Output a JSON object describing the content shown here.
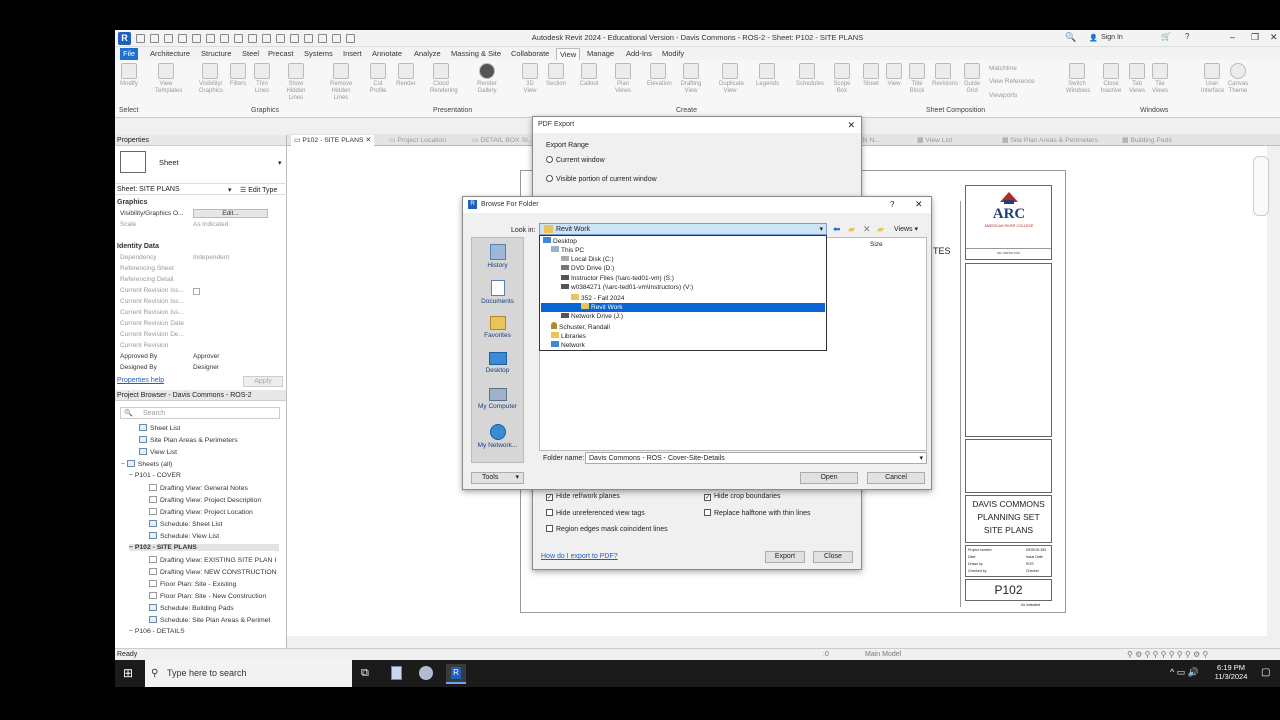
{
  "window": {
    "title": "Autodesk Revit 2024 - Educational Version - Davis Commons - ROS-2 - Sheet: P102 - SITE PLANS",
    "sign_in": "Sign In"
  },
  "ribbon_tabs": [
    "File",
    "Architecture",
    "Structure",
    "Steel",
    "Precast",
    "Systems",
    "Insert",
    "Annotate",
    "Analyze",
    "Massing & Site",
    "Collaborate",
    "View",
    "Manage",
    "Add-Ins",
    "Modify"
  ],
  "ribbon_tools": [
    "Modify",
    "View Templates",
    "Visibility/ Graphics",
    "Filters",
    "Thin Lines",
    "Show Hidden Lines",
    "Remove Hidden Lines",
    "Cut Profile",
    "Render",
    "Cloud Rendering",
    "Render Gallery",
    "3D View",
    "Section",
    "Callout",
    "Plan Views",
    "Elevation",
    "Drafting View",
    "Duplicate View",
    "Legends",
    "Schedules",
    "Scope Box",
    "Sheet",
    "View",
    "Title Block",
    "Revisions",
    "Guide Grid",
    "Matchline",
    "View Reference",
    "Viewports",
    "Switch Windows",
    "Close Inactive",
    "Tab Views",
    "Tile Views",
    "User Interface",
    "Canvas Theme"
  ],
  "ribbon_panels": [
    "Select",
    "Graphics",
    "Presentation",
    "Create",
    "Sheet Composition",
    "Windows"
  ],
  "properties": {
    "header": "Properties",
    "type": "Sheet",
    "selector": "Sheet: SITE PLANS",
    "edit_type": "Edit Type",
    "groups": {
      "graphics": "Graphics",
      "identity": "Identity Data"
    },
    "rows": [
      {
        "k": "Visibility/Graphics O...",
        "v": "Edit..."
      },
      {
        "k": "Scale",
        "v": "As indicated"
      },
      {
        "k": "Dependency",
        "v": "Independent"
      },
      {
        "k": "Referencing Sheet",
        "v": ""
      },
      {
        "k": "Referencing Detail",
        "v": ""
      },
      {
        "k": "Current Revision Iss...",
        "v": ""
      },
      {
        "k": "Current Revision Iss...",
        "v": ""
      },
      {
        "k": "Current Revision Iss...",
        "v": ""
      },
      {
        "k": "Current Revision Date",
        "v": ""
      },
      {
        "k": "Current Revision De...",
        "v": ""
      },
      {
        "k": "Current Revision",
        "v": ""
      },
      {
        "k": "Approved By",
        "v": "Approver"
      },
      {
        "k": "Designed By",
        "v": "Designer"
      }
    ],
    "help": "Properties help",
    "apply": "Apply"
  },
  "project_browser": {
    "header": "Project Browser - Davis Commons - ROS-2",
    "search_placeholder": "Search",
    "items": [
      "Sheet List",
      "Site Plan Areas & Perimeters",
      "View List",
      "Sheets (all)",
      "P101 - COVER",
      "Drafting View: General Notes",
      "Drafting View: Project Description",
      "Drafting View: Project Location",
      "Schedule: Sheet List",
      "Schedule: View List",
      "P102 - SITE PLANS",
      "Drafting View: EXISTING SITE PLAN I",
      "Drafting View: NEW CONSTRUCTION",
      "Floor Plan: Site - Existing",
      "Floor Plan: Site - New Construction",
      "Schedule: Building Pads",
      "Schedule: Site Plan Areas & Perimet",
      "P106 - DETAILS"
    ]
  },
  "view_tabs": [
    "P102 - SITE PLANS",
    "Project Location",
    "DETAIL BOX SI...",
    "... PLAN N...",
    "View List",
    "Site Plan Areas & Perimeters",
    "Building Pads"
  ],
  "sheet": {
    "school": "ARC",
    "school_sub": "AMERICAN RIVER COLLEGE",
    "school_url": "arc.losrios.edu",
    "project": [
      "DAVIS COMMONS",
      "PLANNING SET",
      "SITE PLANS"
    ],
    "number": "P102",
    "tbl_labels": [
      "Project number",
      "Date",
      "Drawn by",
      "Checked by"
    ],
    "tbl_values": [
      "DESIGN 352",
      "Issue Date",
      "ROS",
      "Checker"
    ],
    "scale": "As indicated",
    "note_tag": "TES"
  },
  "pdf_export": {
    "title": "PDF Export",
    "export_range": "Export Range",
    "current_window": "Current window",
    "visible_portion": "Visible portion of current window",
    "options": [
      {
        "label": "Hide ref/work planes",
        "checked": true
      },
      {
        "label": "Hide crop boundaries",
        "checked": true
      },
      {
        "label": "Hide unreferenced view tags",
        "checked": false
      },
      {
        "label": "Replace halftone with thin lines",
        "checked": false
      },
      {
        "label": "Region edges mask coincident lines",
        "checked": false
      }
    ],
    "help_link": "How do I export to PDF?",
    "export": "Export",
    "close": "Close"
  },
  "browse": {
    "title": "Browse For Folder",
    "look_in": "Look in:",
    "current": "Revit Work",
    "size_col": "Size",
    "views": "Views",
    "places": [
      "History",
      "Documents",
      "Favorites",
      "Desktop",
      "My Computer",
      "My Network..."
    ],
    "folders": [
      "Desktop",
      "This PC",
      "Local Disk (C:)",
      "DVD Drive (D:)",
      "Instructor Files (\\\\arc-ted01-vm) (S:)",
      "w0384271 (\\\\arc-ted01-vm\\Instructors) (V:)",
      "352 - Fall 2024",
      "Revit Work",
      "Network Drive (J:)",
      "Schuster, Randall",
      "Libraries",
      "Network"
    ],
    "folder_name_label": "Folder name:",
    "folder_name": "Davis Commons - ROS - Cover-Site-Details",
    "tools": "Tools",
    "open": "Open",
    "cancel": "Cancel"
  },
  "status": {
    "ready": "Ready",
    "model": "Main Model",
    "scale": ":0"
  },
  "taskbar": {
    "search": "Type here to search",
    "time": "6:19 PM",
    "date": "11/3/2024"
  },
  "colors": {
    "accent": "#1f6fcf",
    "selection": "#0a64d6",
    "arc_red": "#b02a2a",
    "arc_blue": "#1c3f7a"
  }
}
